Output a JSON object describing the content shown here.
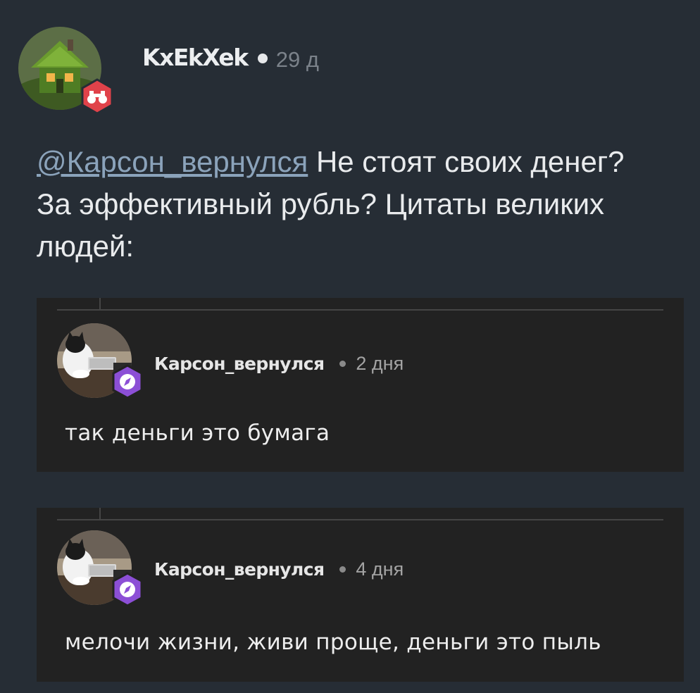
{
  "post": {
    "author": "KxEkXek",
    "time": "29 д",
    "mention": "@Карсон_вернулся",
    "text": " Не стоят своих денег? За эффективный рубль? Цитаты великих людей:"
  },
  "quotes": [
    {
      "author": "Карсон_вернулся",
      "time": "2 дня",
      "text": "так деньги это бумага"
    },
    {
      "author": "Карсон_вернулся",
      "time": "4 дня",
      "text": "мелочи жизни, живи проще, деньги это пыль"
    }
  ],
  "icons": {
    "main_avatar": "moss-house-avatar",
    "main_badge": "binoculars-badge-icon",
    "quote_avatar": "cat-at-keyboard-avatar",
    "quote_badge": "compass-badge-icon"
  },
  "colors": {
    "background": "#262d35",
    "quote_card": "#222222",
    "mention": "#8ba3bb",
    "badge_red": "#e0424a",
    "badge_purple": "#8c4fd6"
  }
}
